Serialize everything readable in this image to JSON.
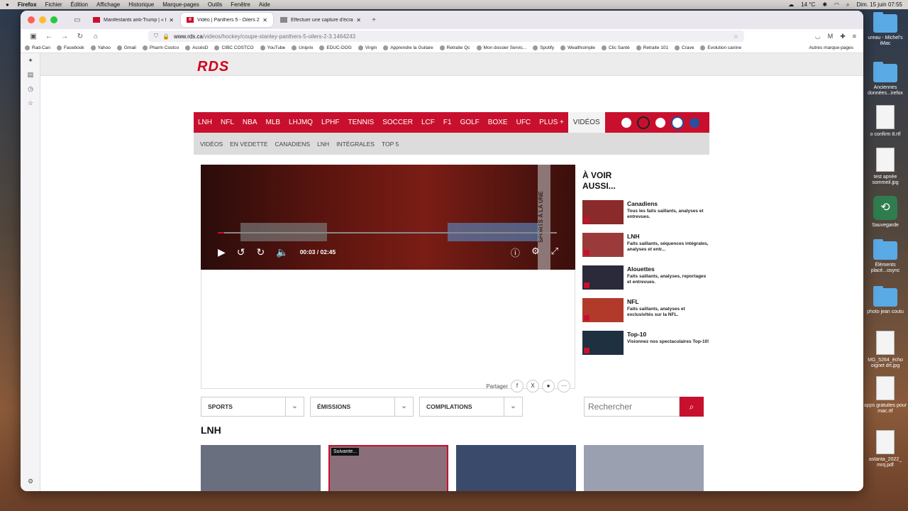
{
  "menubar": {
    "apple": "",
    "app": "Firefox",
    "items": [
      "Fichier",
      "Édition",
      "Affichage",
      "Historique",
      "Marque-pages",
      "Outils",
      "Fenêtre",
      "Aide"
    ],
    "temperature": "14 °C",
    "datetime": "Dim. 15 juin 07:55"
  },
  "tabs": [
    {
      "title": "Manifestants anti-Trump | « Pas",
      "active": false
    },
    {
      "title": "Vidéo | Panthers 5 - Oilers 2",
      "active": true
    },
    {
      "title": "Effectuer une capture d'écran s",
      "active": false
    }
  ],
  "url": {
    "domain": "www.rds.ca",
    "path": "/videos/hockey/coupe-stanley-panthers-5-oilers-2-3.1464243"
  },
  "bookmarks": [
    "Rad-Can",
    "Facebook",
    "Yahoo",
    "Gmail",
    "Pharm Costco",
    "AccèsD",
    "CIBC COSTCO",
    "YouTube",
    "Uniprix",
    "EDUC-DOG",
    "Virgin",
    "Apprendre la Guitare",
    "Retraite Qc",
    "Mon dossier Servic...",
    "Spotify",
    "Wealthsimple",
    "Clic Santé",
    "Retraite 101",
    "Crave",
    "Evolution canine"
  ],
  "bookmarks_other": "Autres marque-pages",
  "site": {
    "logo": "RDS",
    "nav": [
      "LNH",
      "NFL",
      "NBA",
      "MLB",
      "LHJMQ",
      "LPHF",
      "TENNIS",
      "SOCCER",
      "LCF",
      "F1",
      "GOLF",
      "BOXE",
      "UFC",
      "PLUS +",
      "VIDÉOS"
    ],
    "subnav": [
      "VIDÉOS",
      "EN VEDETTE",
      "CANADIENS",
      "LNH",
      "INTÉGRALES",
      "TOP 5"
    ]
  },
  "player": {
    "time": "00:03 / 02:45",
    "progress": 0.018,
    "side_text": "SPORTS À LA UNE"
  },
  "share_label": "Partager",
  "aside": {
    "title": "À VOIR AUSSI...",
    "items": [
      {
        "title": "Canadiens",
        "desc": "Tous les faits saillants, analyses et entrevues.",
        "color": "#8a2a2a"
      },
      {
        "title": "LNH",
        "desc": "Faits saillants, séquences intégrales, analyses et entr...",
        "color": "#9b3a3a"
      },
      {
        "title": "Alouettes",
        "desc": "Faits saillants, analyses, reportages et entrevues.",
        "color": "#2a2a3a"
      },
      {
        "title": "NFL",
        "desc": "Faits saillants, analyses et exclusivités sur la NFL.",
        "color": "#b23a2a"
      },
      {
        "title": "Top-10",
        "desc": "Visionnez nos spectaculaires Top-10!",
        "color": "#1f3040"
      }
    ]
  },
  "filters": [
    "SPORTS",
    "ÉMISSIONS",
    "COMPILATIONS"
  ],
  "search_placeholder": "Rechercher",
  "section_title": "LNH",
  "cards": [
    {
      "label": "",
      "color": "#6a6f80"
    },
    {
      "label": "Suivante...",
      "color": "#8a6f7a"
    },
    {
      "label": "",
      "color": "#3a4a6a"
    },
    {
      "label": "",
      "color": "#9aa0b0"
    }
  ],
  "desktop": [
    {
      "label": "ureau - Michel's iMac",
      "kind": "folder"
    },
    {
      "label": "Anciennes données...irefox",
      "kind": "folder"
    },
    {
      "label": "o confirm 8.rtf",
      "kind": "doc"
    },
    {
      "label": "test apnée sommeil.jpg",
      "kind": "doc"
    },
    {
      "label": "Sauvegarde",
      "kind": "tm"
    },
    {
      "label": "Éléments placé...osync",
      "kind": "folder"
    },
    {
      "label": "photo jean coutu",
      "kind": "folder"
    },
    {
      "label": "MG_5264_écho oignet drt.jpg",
      "kind": "doc"
    },
    {
      "label": "apps gratuites pour mac.rtf",
      "kind": "doc"
    },
    {
      "label": "astanta_2022_ mrq.pdf",
      "kind": "doc"
    }
  ]
}
